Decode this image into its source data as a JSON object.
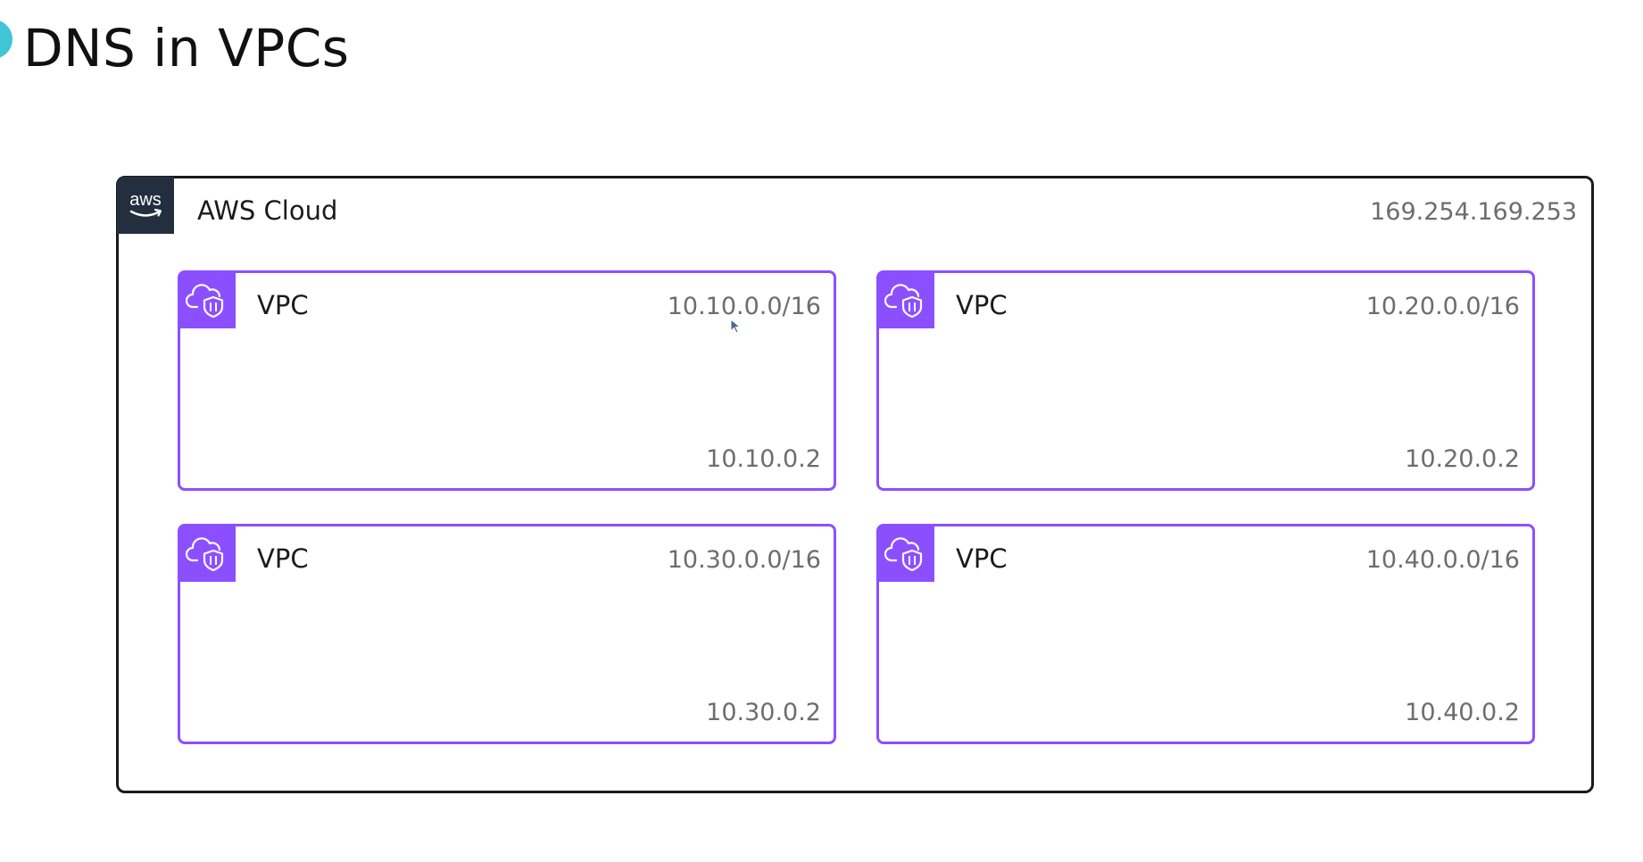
{
  "slide": {
    "title": "DNS in VPCs"
  },
  "cloud": {
    "label": "AWS Cloud",
    "badge_text": "aws",
    "dns_address": "169.254.169.253",
    "border_color": "#1a1a1a",
    "badge_color": "#232f3e"
  },
  "vpcs": [
    {
      "label": "VPC",
      "cidr": "10.10.0.0/16",
      "resolver": "10.10.0.2"
    },
    {
      "label": "VPC",
      "cidr": "10.20.0.0/16",
      "resolver": "10.20.0.2"
    },
    {
      "label": "VPC",
      "cidr": "10.30.0.0/16",
      "resolver": "10.30.0.2"
    },
    {
      "label": "VPC",
      "cidr": "10.40.0.0/16",
      "resolver": "10.40.0.2"
    }
  ],
  "colors": {
    "vpc_accent": "#8c4fff",
    "title_dot": "#3ec6d6",
    "muted_text": "#6d6d6d"
  },
  "icons": {
    "cloud_badge": "aws-logo-icon",
    "vpc_badge": "cloud-shield-icon",
    "pointer": "mouse-cursor-icon"
  }
}
